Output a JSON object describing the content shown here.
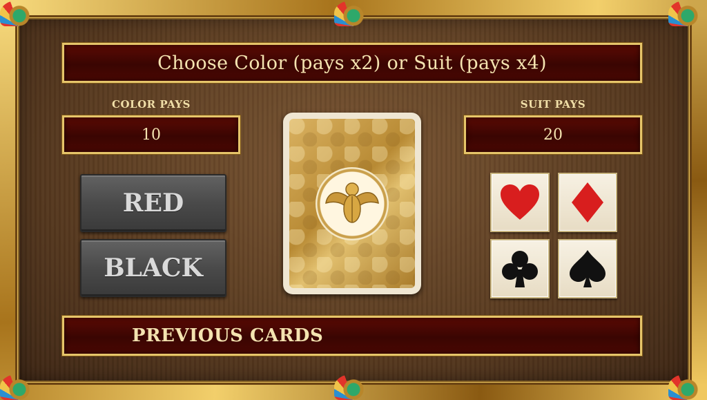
{
  "title": "Choose Color (pays x2) or Suit (pays x4)",
  "color_pays": {
    "label": "COLOR PAYS",
    "value": "10"
  },
  "suit_pays": {
    "label": "SUIT PAYS",
    "value": "20"
  },
  "color_buttons": {
    "red": "RED",
    "black": "BLACK"
  },
  "card": {
    "back_emblem": "scarab-icon"
  },
  "suits": [
    {
      "name": "hearts",
      "icon": "heart-icon",
      "color": "#d81e1e"
    },
    {
      "name": "diamonds",
      "icon": "diamond-icon",
      "color": "#d81e1e"
    },
    {
      "name": "clubs",
      "icon": "club-icon",
      "color": "#111111"
    },
    {
      "name": "spades",
      "icon": "spade-icon",
      "color": "#111111"
    }
  ],
  "previous_cards": {
    "label": "PREVIOUS CARDS"
  },
  "colors": {
    "accent_gold": "#e6c56a",
    "panel_red": "#4a0803",
    "button_gray": "#4a4a4a"
  }
}
